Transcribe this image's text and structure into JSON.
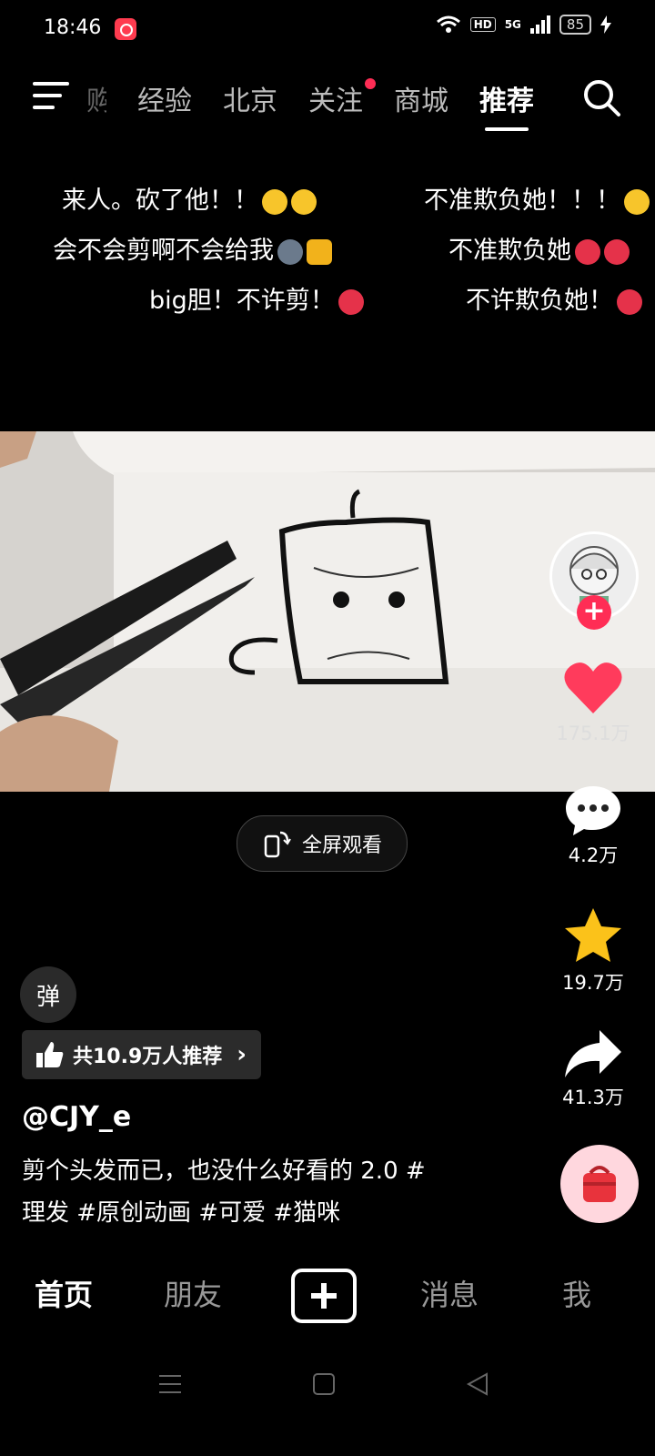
{
  "status_bar": {
    "time": "18:46",
    "network": "5G",
    "hd": "HD",
    "battery": "85"
  },
  "top_nav": {
    "tabs": [
      {
        "label": "购"
      },
      {
        "label": "经验"
      },
      {
        "label": "北京"
      },
      {
        "label": "关注",
        "has_dot": true
      },
      {
        "label": "商城"
      },
      {
        "label": "推荐",
        "active": true
      }
    ]
  },
  "danmaku": {
    "line1_left": "来人。砍了他！！",
    "line1_right": "不准欺负她！！！",
    "line2_left": "会不会剪啊不会给我",
    "line2_right": "不准欺负她",
    "line3_left": "big胆！不许剪！",
    "line3_right": "不许欺负她！"
  },
  "fullscreen": {
    "label": "全屏观看"
  },
  "actions": {
    "likes": "175.1万",
    "comments": "4.2万",
    "favorites": "19.7万",
    "shares": "41.3万"
  },
  "dan_button": {
    "label": "弹"
  },
  "recommend": {
    "label": "共10.9万人推荐"
  },
  "post": {
    "author": "@CJY_e",
    "desc_line1": "剪个头发而已，也没什么好看的 2.0 #",
    "desc_line2": "理发 #原创动画 #可爱 #猫咪"
  },
  "bottom_nav": {
    "home": "首页",
    "friends": "朋友",
    "messages": "消息",
    "me": "我"
  },
  "colors": {
    "accent": "#ff2d55",
    "like": "#ff3b5c",
    "star": "#fbc21a"
  }
}
